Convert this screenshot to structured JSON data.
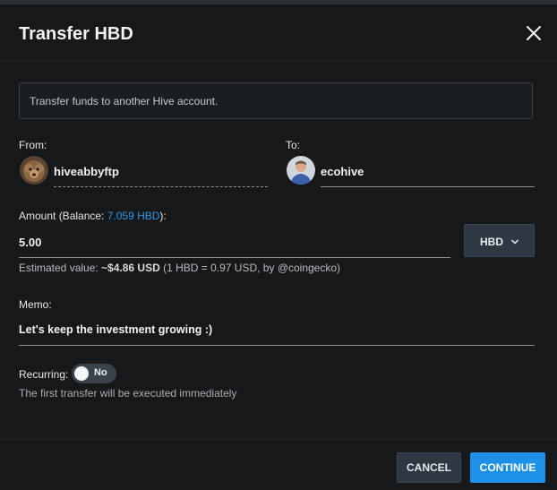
{
  "dialog": {
    "title": "Transfer HBD",
    "info_text": "Transfer funds to another Hive account."
  },
  "from": {
    "label": "From:",
    "username": "hiveabbyftp",
    "avatar_icon": "dog-avatar"
  },
  "to": {
    "label": "To:",
    "username": "ecohive",
    "avatar_icon": "person-avatar"
  },
  "amount": {
    "label_prefix": "Amount (Balance: ",
    "balance": "7.059 HBD",
    "label_suffix": "):",
    "value": "5.00",
    "currency": "HBD",
    "estimate_prefix": "Estimated value: ",
    "estimate_value": "~$4.86 USD",
    "estimate_suffix": " (1 HBD = 0.97 USD, by @coingecko)"
  },
  "memo": {
    "label": "Memo:",
    "value": "Let's keep the investment growing :)"
  },
  "recurring": {
    "label": "Recurring:",
    "toggle_text": "No",
    "note": "The first transfer will be executed immediately"
  },
  "buttons": {
    "cancel": "CANCEL",
    "continue": "CONTINUE"
  },
  "colors": {
    "accent": "#1e90e8",
    "link": "#2f96e6"
  }
}
